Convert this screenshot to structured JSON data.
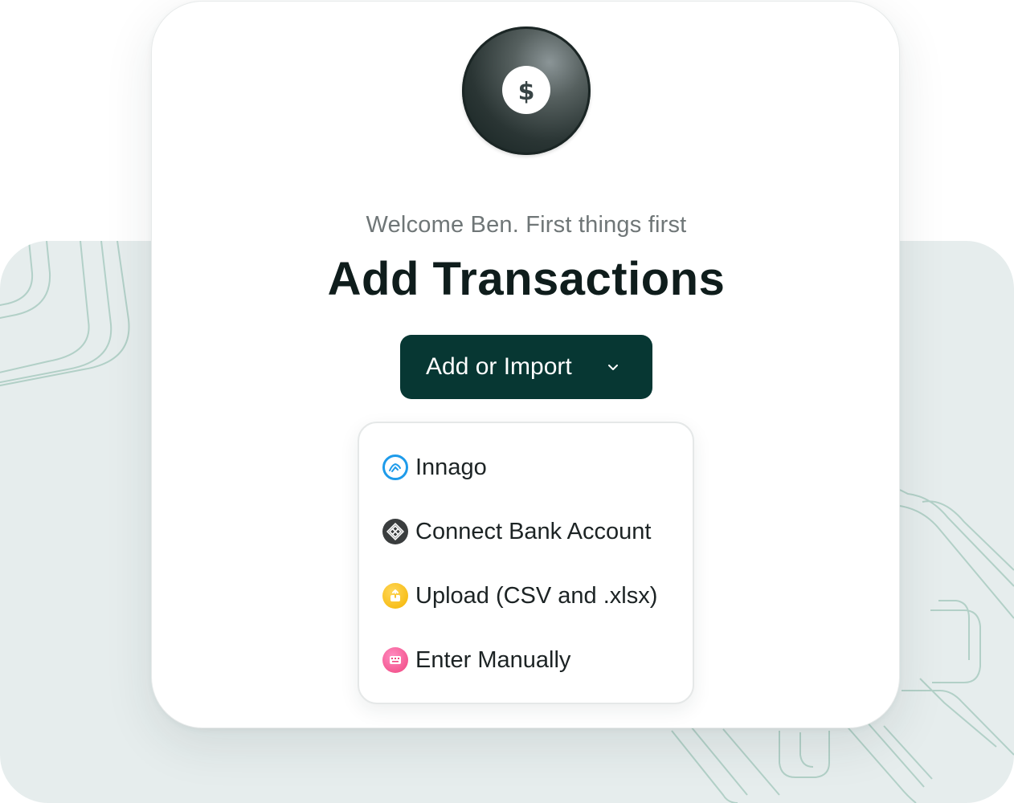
{
  "header": {
    "subtitle": "Welcome Ben. First things first",
    "title": "Add Transactions"
  },
  "cta": {
    "label": "Add or Import",
    "icon": "chevron-down-icon"
  },
  "coin": {
    "icon": "dollar-icon",
    "symbol": "$"
  },
  "menu": {
    "items": [
      {
        "label": "Innago",
        "icon": "innago-icon"
      },
      {
        "label": "Connect Bank Account",
        "icon": "bank-icon"
      },
      {
        "label": "Upload (CSV and .xlsx)",
        "icon": "upload-icon"
      },
      {
        "label": "Enter Manually",
        "icon": "keyboard-icon"
      }
    ]
  },
  "colors": {
    "primary": "#073733",
    "background_panel": "#e6eded",
    "decor_lines": "#a9cbc1",
    "innago_blue": "#1e9bea",
    "upload_yellow": "#f4b400",
    "manual_pink": "#f0447f"
  }
}
